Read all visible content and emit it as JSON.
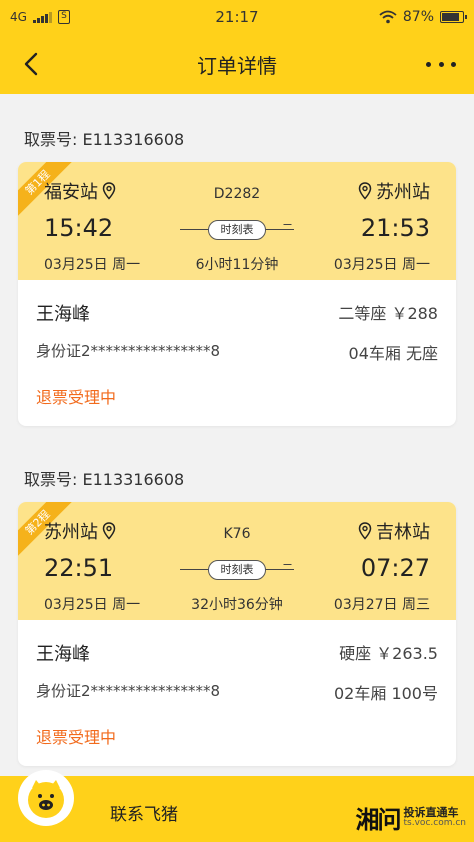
{
  "status_bar": {
    "network": "4G",
    "time": "21:17",
    "battery": "87%",
    "battery_level": 0.87
  },
  "header": {
    "title": "订单详情"
  },
  "orders": [
    {
      "ticket_no": "取票号: E113316608",
      "segment": "第1程",
      "from_station": "福安站",
      "to_station": "苏州站",
      "train_no": "D2282",
      "depart_time": "15:42",
      "arrive_time": "21:53",
      "timetable_label": "时刻表",
      "depart_date": "03月25日 周一",
      "arrive_date": "03月25日 周一",
      "duration": "6小时11分钟",
      "passenger_name": "王海峰",
      "seat_info": "二等座 ￥288",
      "id_no": "身份证2****************8",
      "car_info": "04车厢 无座",
      "status": "退票受理中"
    },
    {
      "ticket_no": "取票号: E113316608",
      "segment": "第2程",
      "from_station": "苏州站",
      "to_station": "吉林站",
      "train_no": "K76",
      "depart_time": "22:51",
      "arrive_time": "07:27",
      "timetable_label": "时刻表",
      "depart_date": "03月25日 周一",
      "arrive_date": "03月27日 周三",
      "duration": "32小时36分钟",
      "passenger_name": "王海峰",
      "seat_info": "硬座 ￥263.5",
      "id_no": "身份证2****************8",
      "car_info": "02车厢 100号",
      "status": "退票受理中"
    }
  ],
  "footer": {
    "contact_label": "联系飞猪",
    "watermark_logo": "湘问",
    "watermark_text": "投诉直通车",
    "watermark_url": "ts.voc.com.cn"
  },
  "colors": {
    "brand_yellow": "#ffd11a",
    "trip_bg": "#fde38a",
    "status_orange": "#f26b1d"
  }
}
